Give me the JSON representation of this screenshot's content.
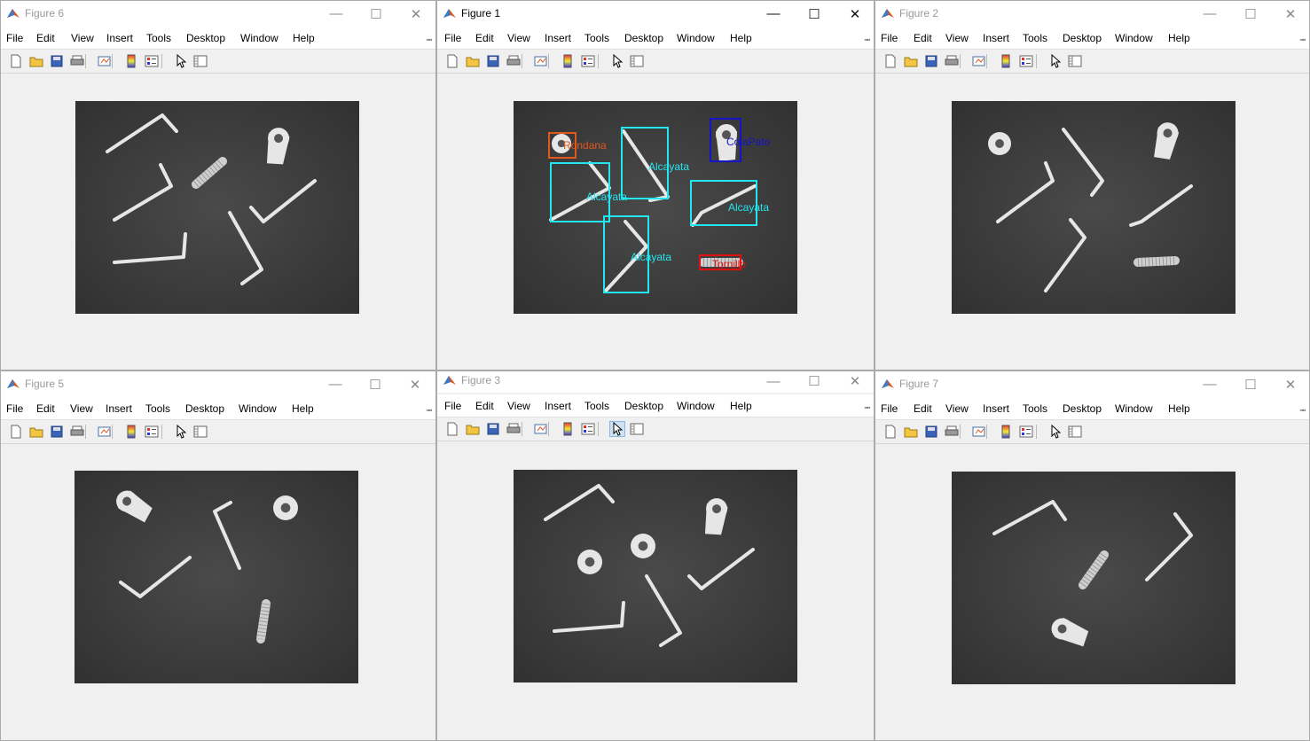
{
  "menu_items": [
    "File",
    "Edit",
    "View",
    "Insert",
    "Tools",
    "Desktop",
    "Window",
    "Help"
  ],
  "window_controls": [
    "minimize-icon",
    "maximize-icon",
    "close-icon"
  ],
  "toolbar_icons": [
    "new-figure-icon",
    "open-file-icon",
    "save-icon",
    "print-icon",
    "link-plot-icon",
    "colorbar-icon",
    "legend-icon",
    "edit-plot-arrow-icon",
    "property-inspector-icon"
  ],
  "windows": [
    {
      "id": "fig6",
      "title": "Figure 6",
      "active": false
    },
    {
      "id": "fig1",
      "title": "Figure 1",
      "active": true
    },
    {
      "id": "fig2",
      "title": "Figure 2",
      "active": false
    },
    {
      "id": "fig5",
      "title": "Figure 5",
      "active": false
    },
    {
      "id": "fig3",
      "title": "Figure 3",
      "active": false,
      "pressed_tool": "edit-plot-arrow-icon"
    },
    {
      "id": "fig7",
      "title": "Figure 7",
      "active": false
    }
  ],
  "detections": [
    {
      "label": "Rondana",
      "color": "#e0581c"
    },
    {
      "label": "ColaPato",
      "color": "#1414c8"
    },
    {
      "label": "Alcayata",
      "color": "#22e6f0"
    },
    {
      "label": "Alcayata",
      "color": "#22e6f0"
    },
    {
      "label": "Alcayata",
      "color": "#22e6f0"
    },
    {
      "label": "Alcayata",
      "color": "#22e6f0"
    },
    {
      "label": "Tornillo",
      "color": "#e01010"
    }
  ],
  "colors": {
    "image_background": "#3a3a3a",
    "object": "#e6e6e6",
    "matlab_orange": "#d9541e"
  }
}
